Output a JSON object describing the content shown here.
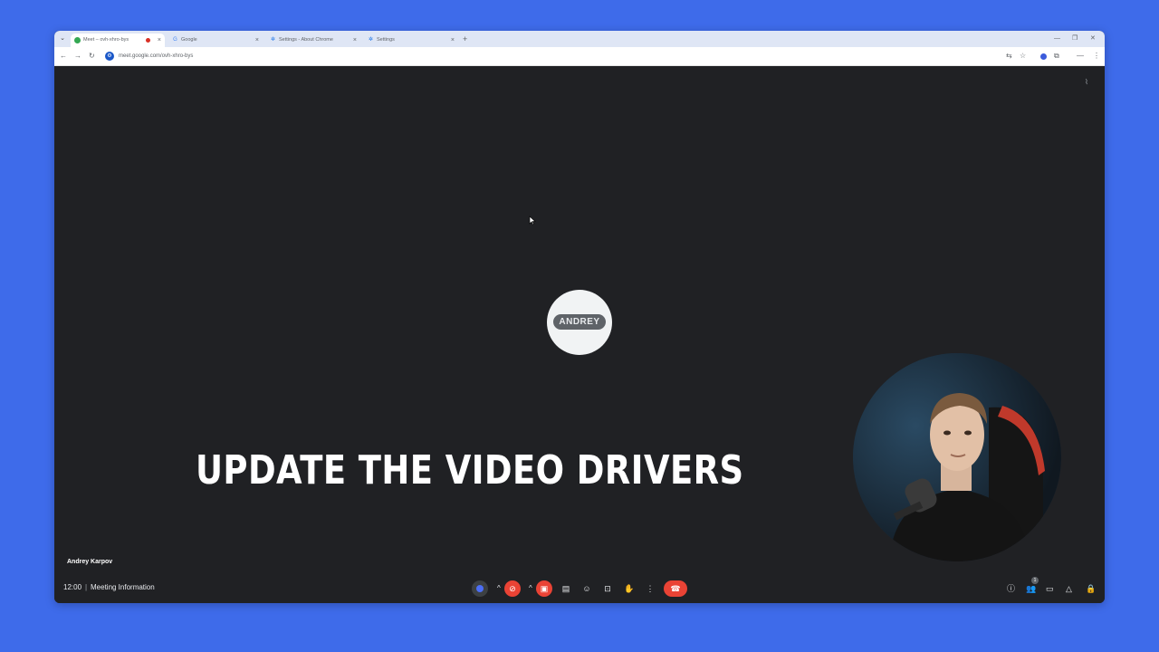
{
  "browser": {
    "tabs": [
      {
        "label": "Meet – ovh-xhro-bys",
        "active": true,
        "icon": "meet-icon",
        "recording": true
      },
      {
        "label": "Google",
        "active": false,
        "icon": "google-icon"
      },
      {
        "label": "Settings - About Chrome",
        "active": false,
        "icon": "gear-icon"
      },
      {
        "label": "Settings",
        "active": false,
        "icon": "gear-icon"
      }
    ],
    "url": "meet.google.com/ovh-xhro-bys",
    "controls": {
      "minimize": "—",
      "maximize": "❐",
      "close": "✕",
      "newtab": "+"
    }
  },
  "meeting": {
    "avatar_label": "ANDREY",
    "caption": "UPDATE THE VIDEO DRIVERS",
    "participant_name": "Andrey Karpov",
    "time": "12:00",
    "separator": "|",
    "info_label": "Meeting Information",
    "participants_count": "1"
  },
  "colors": {
    "page_bg": "#3e6bea",
    "meet_bg": "#202124",
    "danger": "#ea4335",
    "control_bg": "#3c4043"
  }
}
